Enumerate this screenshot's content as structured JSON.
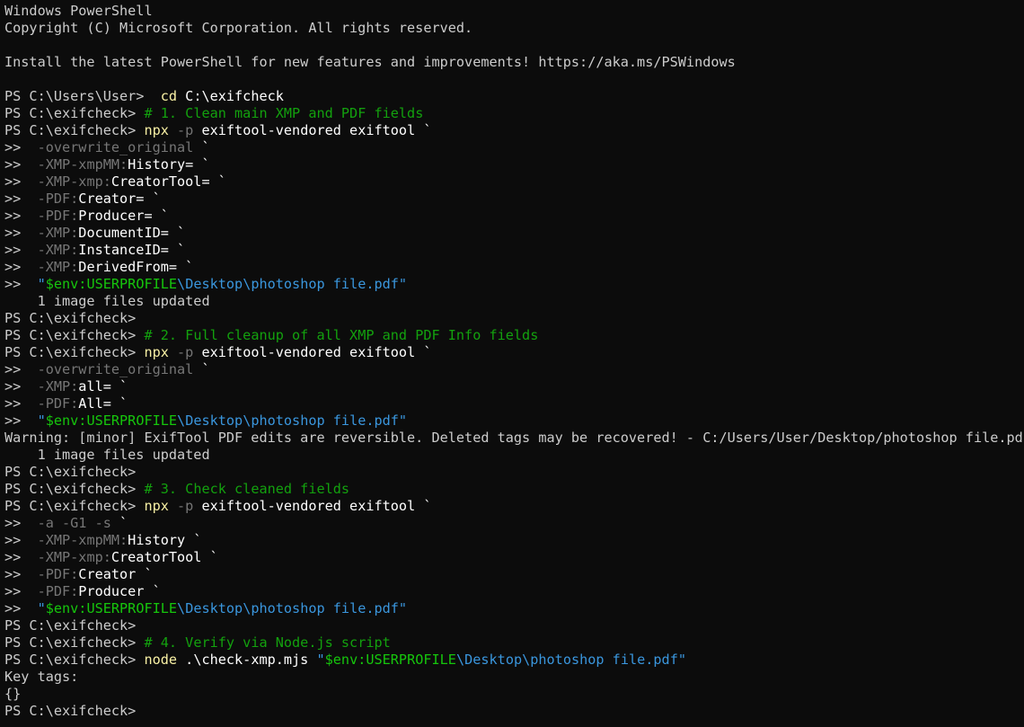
{
  "theme": {
    "background": "#0c0c0c",
    "text": "#cccccc",
    "command": "#f9f1a5",
    "parameter": "#767676",
    "comment": "#13a10e",
    "string": "#3a96dd",
    "variable": "#16c60c"
  },
  "lines": [
    [
      {
        "t": "Windows PowerShell",
        "c": "text"
      }
    ],
    [
      {
        "t": "Copyright (C) Microsoft Corporation. All rights reserved.",
        "c": "text"
      }
    ],
    [],
    [
      {
        "t": "Install the latest PowerShell for new features and improvements! https://aka.ms/PSWindows",
        "c": "text"
      }
    ],
    [],
    [
      {
        "t": "PS C:\\Users\\User> ",
        "c": "prompt"
      },
      {
        "t": " cd",
        "c": "cmd"
      },
      {
        "t": " C:\\exifcheck",
        "c": "white"
      }
    ],
    [
      {
        "t": "PS C:\\exifcheck> ",
        "c": "prompt"
      },
      {
        "t": "# 1. Clean main XMP and PDF fields",
        "c": "comment"
      }
    ],
    [
      {
        "t": "PS C:\\exifcheck> ",
        "c": "prompt"
      },
      {
        "t": "npx",
        "c": "cmd"
      },
      {
        "t": " -p",
        "c": "param"
      },
      {
        "t": " exiftool-vendored exiftool `",
        "c": "white"
      }
    ],
    [
      {
        "t": ">>  ",
        "c": "prompt"
      },
      {
        "t": "-overwrite_original",
        "c": "param"
      },
      {
        "t": " `",
        "c": "white"
      }
    ],
    [
      {
        "t": ">>  ",
        "c": "prompt"
      },
      {
        "t": "-XMP-xmpMM:",
        "c": "param"
      },
      {
        "t": "History=",
        "c": "white"
      },
      {
        "t": " `",
        "c": "white"
      }
    ],
    [
      {
        "t": ">>  ",
        "c": "prompt"
      },
      {
        "t": "-XMP-xmp:",
        "c": "param"
      },
      {
        "t": "CreatorTool=",
        "c": "white"
      },
      {
        "t": " `",
        "c": "white"
      }
    ],
    [
      {
        "t": ">>  ",
        "c": "prompt"
      },
      {
        "t": "-PDF:",
        "c": "param"
      },
      {
        "t": "Creator=",
        "c": "white"
      },
      {
        "t": " `",
        "c": "white"
      }
    ],
    [
      {
        "t": ">>  ",
        "c": "prompt"
      },
      {
        "t": "-PDF:",
        "c": "param"
      },
      {
        "t": "Producer=",
        "c": "white"
      },
      {
        "t": " `",
        "c": "white"
      }
    ],
    [
      {
        "t": ">>  ",
        "c": "prompt"
      },
      {
        "t": "-XMP:",
        "c": "param"
      },
      {
        "t": "DocumentID=",
        "c": "white"
      },
      {
        "t": " `",
        "c": "white"
      }
    ],
    [
      {
        "t": ">>  ",
        "c": "prompt"
      },
      {
        "t": "-XMP:",
        "c": "param"
      },
      {
        "t": "InstanceID=",
        "c": "white"
      },
      {
        "t": " `",
        "c": "white"
      }
    ],
    [
      {
        "t": ">>  ",
        "c": "prompt"
      },
      {
        "t": "-XMP:",
        "c": "param"
      },
      {
        "t": "DerivedFrom=",
        "c": "white"
      },
      {
        "t": " `",
        "c": "white"
      }
    ],
    [
      {
        "t": ">>  ",
        "c": "prompt"
      },
      {
        "t": "\"",
        "c": "str"
      },
      {
        "t": "$env:USERPROFILE",
        "c": "var"
      },
      {
        "t": "\\Desktop\\photoshop file.pdf\"",
        "c": "str"
      }
    ],
    [
      {
        "t": "    1 image files updated",
        "c": "text"
      }
    ],
    [
      {
        "t": "PS C:\\exifcheck>",
        "c": "prompt"
      }
    ],
    [
      {
        "t": "PS C:\\exifcheck> ",
        "c": "prompt"
      },
      {
        "t": "# 2. Full cleanup of all XMP and PDF Info fields",
        "c": "comment"
      }
    ],
    [
      {
        "t": "PS C:\\exifcheck> ",
        "c": "prompt"
      },
      {
        "t": "npx",
        "c": "cmd"
      },
      {
        "t": " -p",
        "c": "param"
      },
      {
        "t": " exiftool-vendored exiftool `",
        "c": "white"
      }
    ],
    [
      {
        "t": ">>  ",
        "c": "prompt"
      },
      {
        "t": "-overwrite_original",
        "c": "param"
      },
      {
        "t": " `",
        "c": "white"
      }
    ],
    [
      {
        "t": ">>  ",
        "c": "prompt"
      },
      {
        "t": "-XMP:",
        "c": "param"
      },
      {
        "t": "all=",
        "c": "white"
      },
      {
        "t": " `",
        "c": "white"
      }
    ],
    [
      {
        "t": ">>  ",
        "c": "prompt"
      },
      {
        "t": "-PDF:",
        "c": "param"
      },
      {
        "t": "All=",
        "c": "white"
      },
      {
        "t": " `",
        "c": "white"
      }
    ],
    [
      {
        "t": ">>  ",
        "c": "prompt"
      },
      {
        "t": "\"",
        "c": "str"
      },
      {
        "t": "$env:USERPROFILE",
        "c": "var"
      },
      {
        "t": "\\Desktop\\photoshop file.pdf\"",
        "c": "str"
      }
    ],
    [
      {
        "t": "Warning: [minor] ExifTool PDF edits are reversible. Deleted tags may be recovered! - C:/Users/User/Desktop/photoshop file.pdf",
        "c": "text"
      }
    ],
    [
      {
        "t": "    1 image files updated",
        "c": "text"
      }
    ],
    [
      {
        "t": "PS C:\\exifcheck>",
        "c": "prompt"
      }
    ],
    [
      {
        "t": "PS C:\\exifcheck> ",
        "c": "prompt"
      },
      {
        "t": "# 3. Check cleaned fields",
        "c": "comment"
      }
    ],
    [
      {
        "t": "PS C:\\exifcheck> ",
        "c": "prompt"
      },
      {
        "t": "npx",
        "c": "cmd"
      },
      {
        "t": " -p",
        "c": "param"
      },
      {
        "t": " exiftool-vendored exiftool `",
        "c": "white"
      }
    ],
    [
      {
        "t": ">>  ",
        "c": "prompt"
      },
      {
        "t": "-a -G1 -s",
        "c": "param"
      },
      {
        "t": " `",
        "c": "white"
      }
    ],
    [
      {
        "t": ">>  ",
        "c": "prompt"
      },
      {
        "t": "-XMP-xmpMM:",
        "c": "param"
      },
      {
        "t": "History",
        "c": "white"
      },
      {
        "t": " `",
        "c": "white"
      }
    ],
    [
      {
        "t": ">>  ",
        "c": "prompt"
      },
      {
        "t": "-XMP-xmp:",
        "c": "param"
      },
      {
        "t": "CreatorTool",
        "c": "white"
      },
      {
        "t": " `",
        "c": "white"
      }
    ],
    [
      {
        "t": ">>  ",
        "c": "prompt"
      },
      {
        "t": "-PDF:",
        "c": "param"
      },
      {
        "t": "Creator",
        "c": "white"
      },
      {
        "t": " `",
        "c": "white"
      }
    ],
    [
      {
        "t": ">>  ",
        "c": "prompt"
      },
      {
        "t": "-PDF:",
        "c": "param"
      },
      {
        "t": "Producer",
        "c": "white"
      },
      {
        "t": " `",
        "c": "white"
      }
    ],
    [
      {
        "t": ">>  ",
        "c": "prompt"
      },
      {
        "t": "\"",
        "c": "str"
      },
      {
        "t": "$env:USERPROFILE",
        "c": "var"
      },
      {
        "t": "\\Desktop\\photoshop file.pdf\"",
        "c": "str"
      }
    ],
    [
      {
        "t": "PS C:\\exifcheck>",
        "c": "prompt"
      }
    ],
    [
      {
        "t": "PS C:\\exifcheck> ",
        "c": "prompt"
      },
      {
        "t": "# 4. Verify via Node.js script",
        "c": "comment"
      }
    ],
    [
      {
        "t": "PS C:\\exifcheck> ",
        "c": "prompt"
      },
      {
        "t": "node",
        "c": "cmd"
      },
      {
        "t": " .\\check-xmp.mjs ",
        "c": "white"
      },
      {
        "t": "\"",
        "c": "str"
      },
      {
        "t": "$env:USERPROFILE",
        "c": "var"
      },
      {
        "t": "\\Desktop\\photoshop file.pdf\"",
        "c": "str"
      }
    ],
    [
      {
        "t": "Key tags:",
        "c": "text"
      }
    ],
    [
      {
        "t": "{}",
        "c": "text"
      }
    ],
    [
      {
        "t": "PS C:\\exifcheck>",
        "c": "prompt"
      }
    ]
  ]
}
